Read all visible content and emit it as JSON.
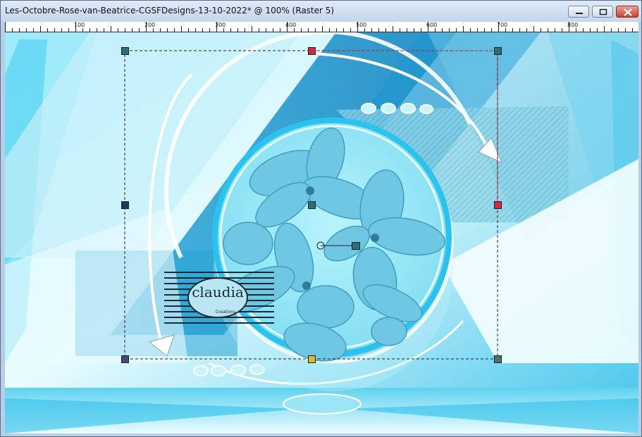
{
  "window": {
    "title": "Les-Octobre-Rose-van-Beatrice-CGSFDesigns-13-10-2022* @ 100% (Raster 5)",
    "controls": [
      "minimize",
      "maximize",
      "close"
    ]
  },
  "ruler": {
    "labels": [
      "100",
      "200",
      "300",
      "400",
      "500",
      "600",
      "700",
      "800"
    ]
  },
  "watermark": {
    "name": "claudia",
    "subtext": "Creations"
  },
  "colors": {
    "title_bar_top": "#dfeaf7",
    "title_bar_bottom": "#c3d6ec",
    "close_button": "#c64530",
    "canvas_light": "#e8fbff",
    "canvas_cyan": "#4fd3f0",
    "canvas_blue": "#1f9bd0",
    "circle_fill": "#9eeaf7",
    "handle_teal": "#2f6f74",
    "handle_red": "#d9243d",
    "handle_navy": "#23365a"
  },
  "icons": {
    "minimize": "minimize-icon",
    "maximize": "maximize-icon",
    "close": "close-icon",
    "rotation_handle": "rotation-handle-icon"
  }
}
